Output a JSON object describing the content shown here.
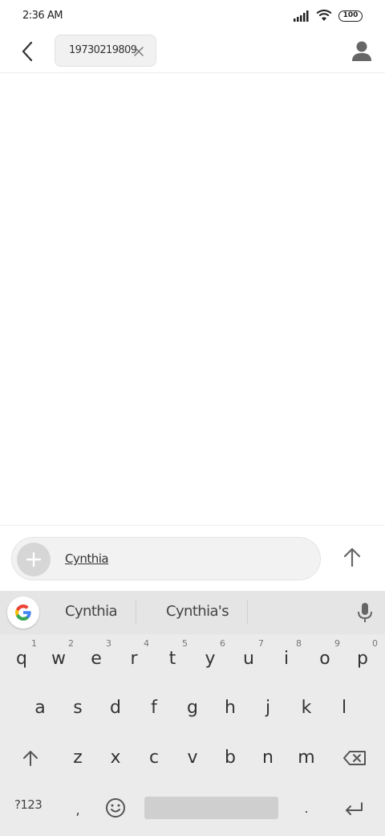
{
  "status_bar": {
    "time": "2:36 AM",
    "battery": "100"
  },
  "header": {
    "recipient": "19730219809"
  },
  "compose": {
    "text": "Cynthia"
  },
  "keyboard": {
    "suggestions": [
      "Cynthia",
      "Cynthia's"
    ],
    "row1": [
      {
        "key": "q",
        "num": "1"
      },
      {
        "key": "w",
        "num": "2"
      },
      {
        "key": "e",
        "num": "3"
      },
      {
        "key": "r",
        "num": "4"
      },
      {
        "key": "t",
        "num": "5"
      },
      {
        "key": "y",
        "num": "6"
      },
      {
        "key": "u",
        "num": "7"
      },
      {
        "key": "i",
        "num": "8"
      },
      {
        "key": "o",
        "num": "9"
      },
      {
        "key": "p",
        "num": "0"
      }
    ],
    "row2": [
      "a",
      "s",
      "d",
      "f",
      "g",
      "h",
      "j",
      "k",
      "l"
    ],
    "row3": [
      "z",
      "x",
      "c",
      "v",
      "b",
      "n",
      "m"
    ],
    "symbols_label": "?123",
    "comma": ",",
    "period": "."
  }
}
